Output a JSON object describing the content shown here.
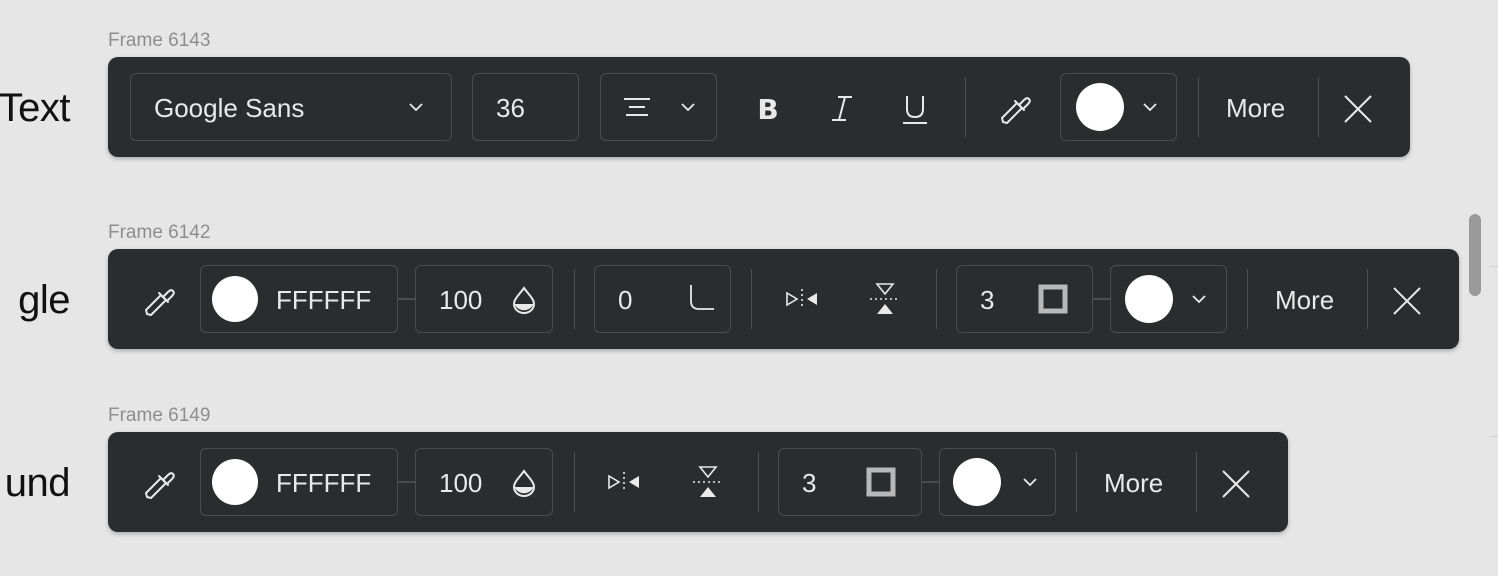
{
  "rows": [
    {
      "label": "Text",
      "frame": "Frame 6143",
      "font": "Google Sans",
      "size": "36",
      "more": "More"
    },
    {
      "label": "gle",
      "frame": "Frame 6142",
      "hex": "FFFFFF",
      "opacity": "100",
      "radius": "0",
      "stroke": "3",
      "more": "More"
    },
    {
      "label": "und",
      "frame": "Frame 6149",
      "hex": "FFFFFF",
      "opacity": "100",
      "stroke": "3",
      "more": "More"
    }
  ],
  "colors": {
    "page_bg": "#e6e6e6",
    "toolbar_bg": "#2a2c2e",
    "border": "#4a4d50",
    "text": "#e9e9e9",
    "swatch": "#ffffff"
  },
  "icons": [
    "chevron-down-icon",
    "align-icon",
    "bold-icon",
    "italic-icon",
    "underline-icon",
    "eyedropper-icon",
    "opacity-drop-icon",
    "corner-radius-icon",
    "flip-horizontal-icon",
    "flip-vertical-icon",
    "stroke-square-icon",
    "close-icon"
  ]
}
